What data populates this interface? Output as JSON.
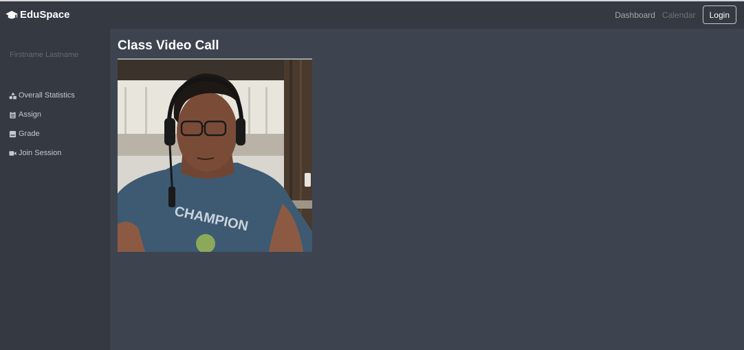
{
  "navbar": {
    "brand": "EduSpace",
    "brand_icon": "graduation-cap-icon",
    "links": [
      {
        "label": "Dashboard",
        "state": "active"
      },
      {
        "label": "Calendar",
        "state": "disabled"
      }
    ],
    "login_label": "Login"
  },
  "sidebar": {
    "user_name": "Firstname Lastname",
    "items": [
      {
        "label": "Overall Statistics",
        "icon": "shapes-icon"
      },
      {
        "label": "Assign",
        "icon": "clipboard-icon"
      },
      {
        "label": "Grade",
        "icon": "grade-book-icon"
      },
      {
        "label": "Join Session",
        "icon": "video-camera-icon"
      }
    ]
  },
  "main": {
    "title": "Class Video Call",
    "video": {
      "shirt_text": "CHAMPION"
    }
  },
  "colors": {
    "navbar_bg": "#343942",
    "page_bg": "#3e4350",
    "title_rule": "#9aa4a0"
  }
}
